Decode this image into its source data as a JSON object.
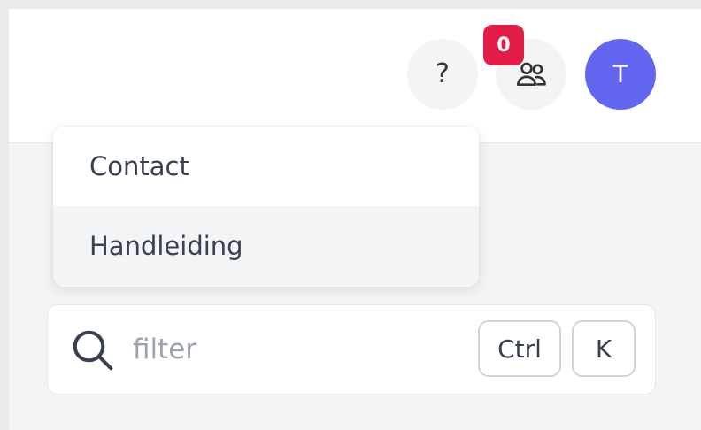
{
  "header": {
    "help_icon": "?",
    "team_badge_count": "0",
    "avatar_initial": "T"
  },
  "colors": {
    "avatar_bg": "#6366f1",
    "badge_bg": "#e11d48"
  },
  "icons": {
    "help": "question-mark-icon",
    "team": "users-icon",
    "search": "search-icon"
  },
  "dropdown": {
    "items": [
      {
        "label": "Contact"
      },
      {
        "label": "Handleiding"
      }
    ]
  },
  "filter": {
    "value": "",
    "placeholder": "filter",
    "shortcut": [
      "Ctrl",
      "K"
    ]
  }
}
